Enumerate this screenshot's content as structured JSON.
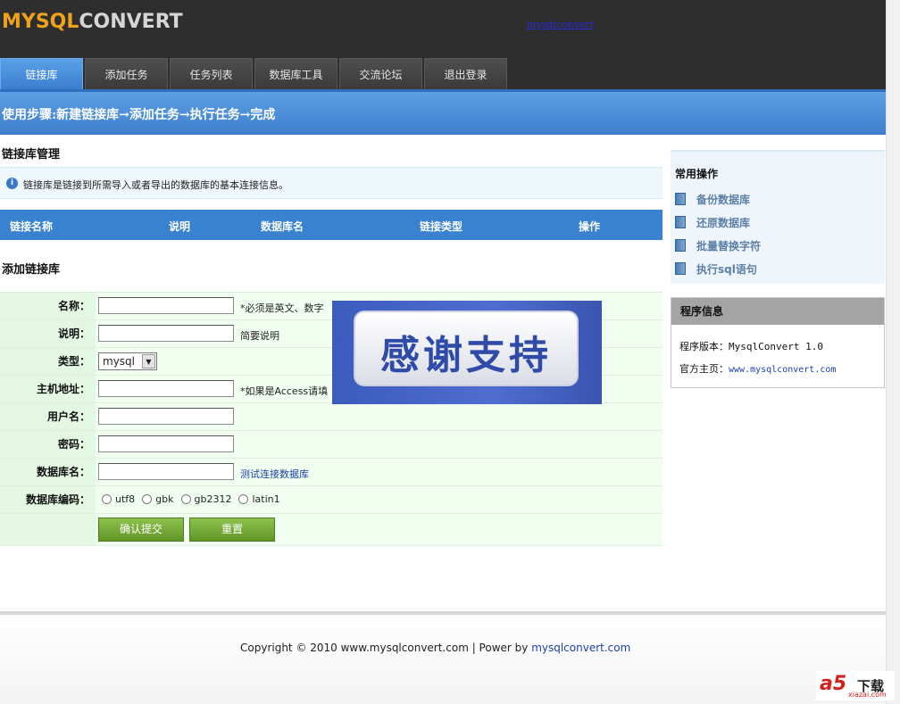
{
  "header": {
    "logo_part1": "MYSQL",
    "logo_part2": "CONVERT",
    "top_link": "mysqlconvert"
  },
  "nav": {
    "tabs": [
      {
        "label": "链接库",
        "active": true
      },
      {
        "label": "添加任务",
        "active": false
      },
      {
        "label": "任务列表",
        "active": false
      },
      {
        "label": "数据库工具",
        "active": false
      },
      {
        "label": "交流论坛",
        "active": false
      },
      {
        "label": "退出登录",
        "active": false
      }
    ]
  },
  "steps": {
    "text": "使用步骤:新建链接库→添加任务→执行任务→完成"
  },
  "main": {
    "manage_title": "链接库管理",
    "notice": "链接库是链接到所需导入或者导出的数据库的基本连接信息。",
    "table_headers": [
      "链接名称",
      "说明",
      "数据库名",
      "链接类型",
      "操作"
    ],
    "add_title": "添加链接库"
  },
  "form": {
    "name_label": "名称：",
    "name_hint": "*必须是英文、数字",
    "desc_label": "说明：",
    "desc_hint": "简要说明",
    "type_label": "类型：",
    "type_value": "mysql",
    "host_label": "主机地址：",
    "host_hint": "*如果是Access请填",
    "user_label": "用户名：",
    "password_label": "密码：",
    "dbname_label": "数据库名：",
    "test_link": "测试连接数据库",
    "encoding_label": "数据库编码：",
    "encodings": [
      "utf8",
      "gbk",
      "gb2312",
      "latin1"
    ],
    "submit_label": "确认提交",
    "reset_label": "重置"
  },
  "sidebar": {
    "common_title": "常用操作",
    "items": [
      "备份数据库",
      "还原数据库",
      "批量替换字符",
      "执行sql语句"
    ],
    "info_title": "程序信息",
    "version_label": "程序版本：",
    "version_value": "MysqlConvert 1.0",
    "homepage_label": "官方主页：",
    "homepage_value": "www.mysqlconvert.com"
  },
  "banner": {
    "text": "感谢支持"
  },
  "footer": {
    "copyright": "Copyright © 2010 www.mysqlconvert.com | Power by ",
    "power_link": "mysqlconvert.com"
  },
  "watermark": {
    "logo": "a5",
    "label": "下载",
    "site": "xiazai.com"
  }
}
